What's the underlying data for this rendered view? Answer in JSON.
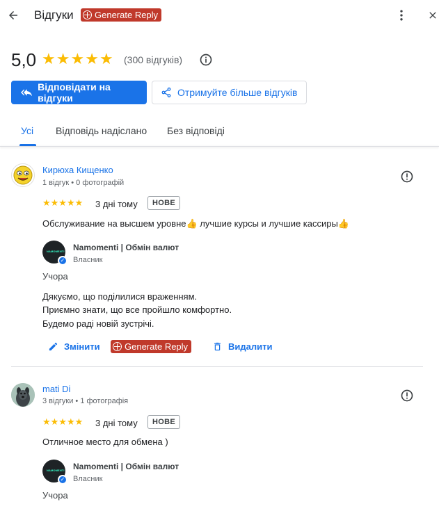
{
  "header": {
    "title": "Відгуки",
    "generate_reply_label": "Generate Reply"
  },
  "summary": {
    "rating": "5,0",
    "stars": 5,
    "count_text": "(300 відгуків)"
  },
  "buttons": {
    "reply_to_reviews": "Відповідати на відгуки",
    "get_more_reviews": "Отримуйте більше відгуків"
  },
  "tabs": [
    {
      "label": "Усі",
      "active": true
    },
    {
      "label": "Відповідь надіслано",
      "active": false
    },
    {
      "label": "Без відповіді",
      "active": false
    }
  ],
  "reviews": [
    {
      "name": "Кирюха Кищенко",
      "meta": "1 відгук • 0 фотографій",
      "stars": "★★★★★",
      "rating": 5,
      "time": "3 дні тому",
      "badge": "НОВЕ",
      "text": "Обслуживание на высшем уровне👍 лучшие курсы и лучшие кассиры👍",
      "owner": {
        "name": "Namomenti | Обмін валют",
        "role": "Власник",
        "date": "Учора",
        "reply_lines": [
          "Дякуємо, що поділилися враженням.",
          "Приємно знати, що все пройшло комфортно.",
          "Будемо раді новій зустрічі."
        ]
      },
      "actions": {
        "edit": "Змінити",
        "generate": "Generate Reply",
        "delete": "Видалити"
      }
    },
    {
      "name": "mati Di",
      "meta": "3 відгуки • 1 фотографія",
      "stars": "★★★★★",
      "rating": 5,
      "time": "3 дні тому",
      "badge": "НОВЕ",
      "text": "Отличное место для обмена )",
      "owner": {
        "name": "Namomenti | Обмін валют",
        "role": "Власник",
        "date": "Учора"
      }
    }
  ],
  "colors": {
    "accent": "#1a73e8",
    "star": "#fbbc04",
    "generate_reply": "#c0392b"
  }
}
